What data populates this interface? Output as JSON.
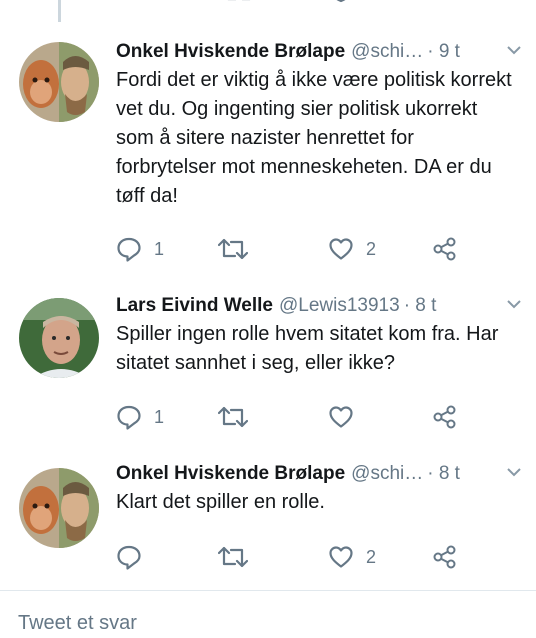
{
  "tweets": [
    {
      "name": "Onkel Hviskende Brølape",
      "handle": "@schi…",
      "time": "· 9 t",
      "text": "Fordi det er viktig å ikke være politisk korrekt vet du. Og ingenting sier politisk ukorrekt som å sitere nazister henrettet for forbrytelser mot menneskeheten. DA er du tøff da!",
      "replies": "1",
      "likes": "2"
    },
    {
      "name": "Lars Eivind Welle",
      "handle": "@Lewis13913",
      "time": "· 8 t",
      "text": "Spiller ingen rolle hvem sitatet kom fra. Har sitatet sannhet i seg, eller ikke?",
      "replies": "1",
      "likes": ""
    },
    {
      "name": "Onkel Hviskende Brølape",
      "handle": "@schi…",
      "time": "· 8 t",
      "text": "Klart det spiller en rolle.",
      "replies": "",
      "likes": "2"
    }
  ],
  "reply_placeholder": "Tweet et svar",
  "icons": [
    "reply-icon",
    "retweet-icon",
    "like-icon",
    "share-icon",
    "chevron-down-icon"
  ],
  "colors": {
    "text": "#14171a",
    "muted": "#657786",
    "thread_line": "#ccd6dd",
    "divider": "#e1e8ed"
  }
}
